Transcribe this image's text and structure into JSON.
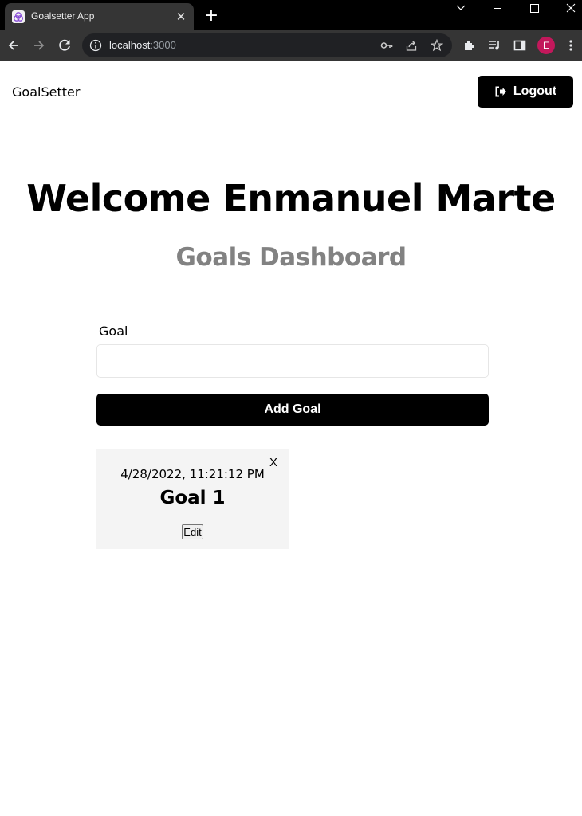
{
  "browser": {
    "tab_title": "Goalsetter App",
    "url_host": "localhost",
    "url_port": ":3000",
    "profile_initial": "E",
    "profile_color": "#c2185b"
  },
  "header": {
    "brand": "GoalSetter",
    "logout_label": "Logout"
  },
  "main": {
    "welcome": "Welcome Enmanuel Marte",
    "subtitle": "Goals Dashboard",
    "form": {
      "goal_label": "Goal",
      "goal_value": "",
      "add_label": "Add Goal"
    },
    "goals": [
      {
        "date": "4/28/2022, 11:21:12 PM",
        "text": "Goal 1",
        "delete_label": "X",
        "edit_label": "Edit"
      }
    ]
  },
  "colors": {
    "button_bg": "#000000",
    "subtitle": "#828282",
    "card_bg": "#f4f4f4"
  }
}
